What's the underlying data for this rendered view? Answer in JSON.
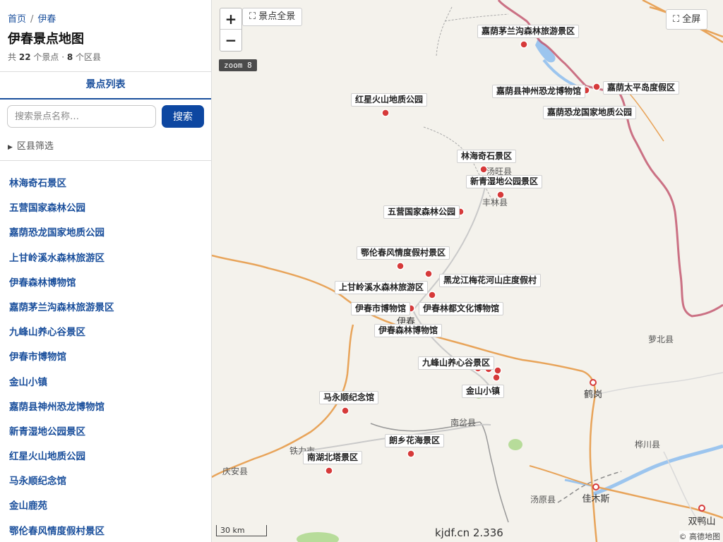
{
  "breadcrumb": {
    "home": "首页",
    "separator": "/",
    "current": "伊春"
  },
  "page_title": "伊春景点地图",
  "stats": {
    "prefix": "共",
    "spot_count": "22",
    "spot_unit": "个景点 ·",
    "district_count": "8",
    "district_unit": "个区县"
  },
  "tab_label": "景点列表",
  "search": {
    "placeholder": "搜索景点名称…",
    "button": "搜索"
  },
  "filter_label": "区县筛选",
  "spot_list": [
    "林海奇石景区",
    "五营国家森林公园",
    "嘉荫恐龙国家地质公园",
    "上甘岭溪水森林旅游区",
    "伊春森林博物馆",
    "嘉荫茅兰沟森林旅游景区",
    "九峰山养心谷景区",
    "伊春市博物馆",
    "金山小镇",
    "嘉荫县神州恐龙博物馆",
    "新青湿地公园景区",
    "红星火山地质公园",
    "马永顺纪念馆",
    "金山鹿苑",
    "鄂伦春风情度假村景区"
  ],
  "map": {
    "zoom_in": "+",
    "zoom_out": "−",
    "overview_button": "⛶ 景点全景",
    "fullscreen_button": "⛶ 全屏",
    "zoom_level": "zoom 8",
    "scale": "30 km",
    "watermark": "kjdf.cn 2.336",
    "attribution": "© 高德地图",
    "colors": {
      "marker": "#d63a3a",
      "road_main": "#e8a45a",
      "border": "#c0506a",
      "water": "#9cc5ee",
      "land": "#f4f2ec"
    },
    "markers": [
      {
        "label": "嘉荫茅兰沟森林旅游景区"
      },
      {
        "label": "嘉荫县神州恐龙博物馆"
      },
      {
        "label": "嘉荫太平岛度假区"
      },
      {
        "label": "嘉荫恐龙国家地质公园"
      },
      {
        "label": "红星火山地质公园"
      },
      {
        "label": "林海奇石景区"
      },
      {
        "label": "新青湿地公园景区"
      },
      {
        "label": "五营国家森林公园"
      },
      {
        "label": "鄂伦春风情度假村景区"
      },
      {
        "label": "黑龙江梅花河山庄度假村"
      },
      {
        "label": "上甘岭溪水森林旅游区"
      },
      {
        "label": "伊春市博物馆"
      },
      {
        "label": "伊春林都文化博物馆"
      },
      {
        "label": "伊春森林博物馆"
      },
      {
        "label": "九峰山养心谷景区"
      },
      {
        "label": "金山小镇"
      },
      {
        "label": "马永顺纪念馆"
      },
      {
        "label": "朗乡花海景区"
      },
      {
        "label": "南湖北塔景区"
      }
    ],
    "places": [
      "汤旺县",
      "丰林县",
      "伊春",
      "萝北县",
      "鹤岗",
      "南岔县",
      "铁力市",
      "庆安县",
      "桦川县",
      "汤原县",
      "佳木斯",
      "双鸭山"
    ]
  }
}
